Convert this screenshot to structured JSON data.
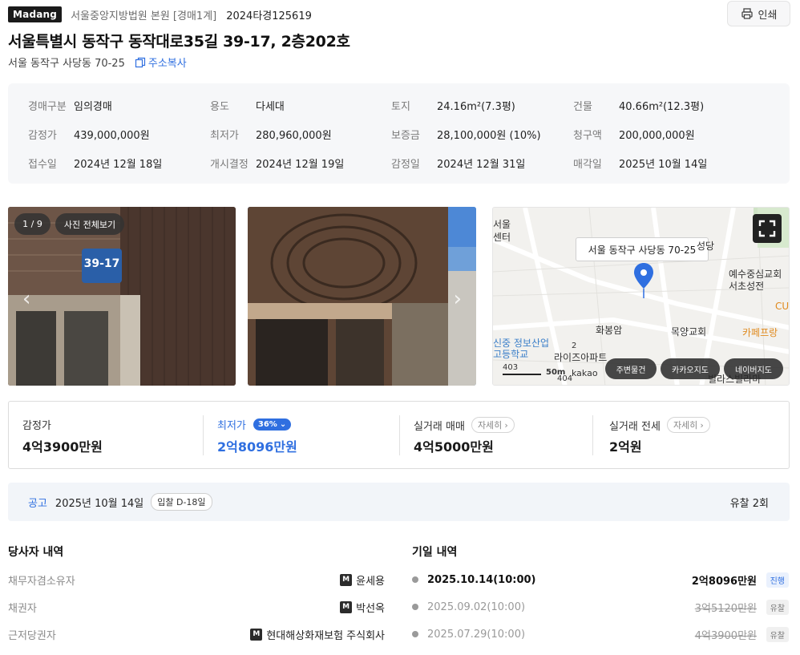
{
  "header": {
    "logo": "Madang",
    "court": "서울중앙지방법원 본원 [경매1계]",
    "case_no": "2024타경125619",
    "print_label": "인쇄"
  },
  "property": {
    "address": "서울특별시 동작구 동작대로35길 39-17, 2층202호",
    "sub_address": "서울 동작구 사당동 70-25",
    "copy_label": "주소복사"
  },
  "info": [
    [
      {
        "k": "경매구분",
        "v": "임의경매"
      },
      {
        "k": "용도",
        "v": "다세대"
      },
      {
        "k": "토지",
        "v": "24.16m²(7.3평)"
      },
      {
        "k": "건물",
        "v": "40.66m²(12.3평)"
      }
    ],
    [
      {
        "k": "감정가",
        "v": "439,000,000원"
      },
      {
        "k": "최저가",
        "v": "280,960,000원"
      },
      {
        "k": "보증금",
        "v": "28,100,000원 (10%)"
      },
      {
        "k": "청구액",
        "v": "200,000,000원"
      }
    ],
    [
      {
        "k": "접수일",
        "v": "2024년 12월 18일"
      },
      {
        "k": "개시결정",
        "v": "2024년 12월 19일"
      },
      {
        "k": "감정일",
        "v": "2024년 12월 31일"
      },
      {
        "k": "매각일",
        "v": "2025년 10월 14일"
      }
    ]
  ],
  "gallery": {
    "counter": "1 / 9",
    "view_all": "사진 전체보기",
    "sign_text": "39-17"
  },
  "map": {
    "popup": "서울 동작구 사당동 70-25",
    "labels": [
      "서울",
      "센터",
      "성당",
      "예수중심교회",
      "서초성전",
      "CU",
      "화봉암",
      "목양교회",
      "카페프랑",
      "신중 정보산업",
      "고등학교",
      "라이즈아파트",
      "빌라스빌라마",
      "403",
      "404",
      "50m",
      "kakao",
      "2"
    ],
    "buttons": [
      "주변물건",
      "카카오지도",
      "네이버지도"
    ]
  },
  "prices": [
    {
      "label": "감정가",
      "value": "4억3900만원"
    },
    {
      "label": "최저가",
      "badge": "36%",
      "value": "2억8096만원"
    },
    {
      "label": "실거래 매매",
      "detail": "자세히",
      "value": "4억5000만원"
    },
    {
      "label": "실거래 전세",
      "detail": "자세히",
      "value": "2억원"
    }
  ],
  "notice": {
    "label": "공고",
    "date": "2025년 10월 14일",
    "dday": "입찰 D-18일",
    "fail_count": "유찰 2회"
  },
  "parties": {
    "title": "당사자 내역",
    "rows": [
      {
        "role": "채무자겸소유자",
        "name": "윤세용"
      },
      {
        "role": "채권자",
        "name": "박선옥"
      },
      {
        "role": "근저당권자",
        "name": "현대해상화재보험 주식회사"
      }
    ],
    "badge": "M"
  },
  "schedule": {
    "title": "기일 내역",
    "rows": [
      {
        "datetime": "2025.10.14(10:00)",
        "amount": "2억8096만원",
        "status": "진행"
      },
      {
        "datetime": "2025.09.02(10:00)",
        "amount": "3억5120만원",
        "status": "유찰"
      },
      {
        "datetime": "2025.07.29(10:00)",
        "amount": "4억3900만원",
        "status": "유찰"
      }
    ]
  },
  "colors": {
    "accent": "#2f6fe0",
    "logo_bg": "#1a1a1a",
    "panel_bg": "#f6f7f9"
  }
}
